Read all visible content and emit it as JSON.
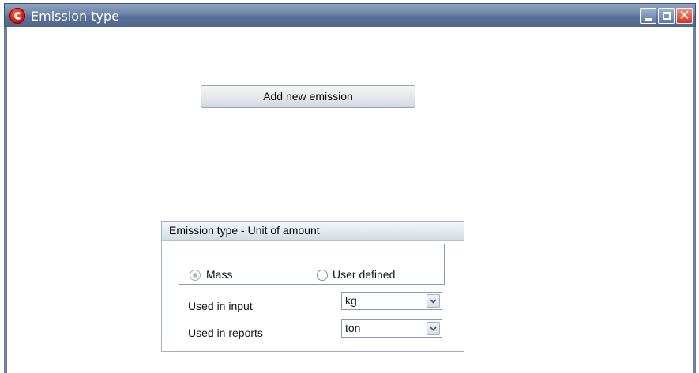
{
  "window": {
    "title": "Emission type",
    "icon": "app-logo-icon",
    "controls": [
      "minimize-icon",
      "maximize-icon",
      "close-icon"
    ],
    "close_glyph": "✕",
    "colors": {
      "titlebar": "#5b7197",
      "close": "#d9321b",
      "accent": "#6a7fa3"
    }
  },
  "main": {
    "add_button_label": "Add new emission"
  },
  "unit_group": {
    "title": "Emission type  - Unit of amount",
    "radios": {
      "mass_label": "Mass",
      "mass_selected": true,
      "user_defined_label": "User defined",
      "user_defined_selected": false
    },
    "used_in_input_label": "Used in input",
    "used_in_input_value": "kg",
    "used_in_reports_label": "Used in reports",
    "used_in_reports_value": "ton"
  }
}
